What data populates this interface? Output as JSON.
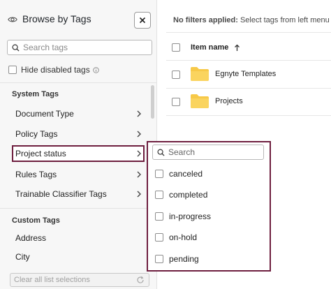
{
  "panel": {
    "title": "Browse by Tags",
    "search_placeholder": "Search tags",
    "hide_disabled_label": "Hide disabled tags",
    "system_tags_title": "System Tags",
    "system_tags": [
      {
        "label": "Document Type"
      },
      {
        "label": "Policy Tags"
      },
      {
        "label": "Project status"
      },
      {
        "label": "Rules Tags"
      },
      {
        "label": "Trainable Classifier Tags"
      }
    ],
    "custom_tags_title": "Custom Tags",
    "custom_tags": [
      {
        "label": "Address"
      },
      {
        "label": "City"
      }
    ],
    "clear_all_label": "Clear all list selections"
  },
  "content": {
    "filter_status_bold": "No filters applied:",
    "filter_status_text": " Select tags from left menu",
    "column_item_name": "Item name",
    "files": [
      {
        "name": "Egnyte Templates"
      },
      {
        "name": "Projects"
      }
    ]
  },
  "popup": {
    "search_placeholder": "Search",
    "options": [
      {
        "label": "canceled"
      },
      {
        "label": "completed"
      },
      {
        "label": "in-progress"
      },
      {
        "label": "on-hold"
      },
      {
        "label": "pending"
      }
    ]
  },
  "colors": {
    "highlight": "#6e1e3f",
    "folder": "#f7c948"
  },
  "icons": [
    "eye-icon",
    "close-icon",
    "search-icon",
    "info-icon",
    "chevron-right-icon",
    "sort-up-icon",
    "folder-icon",
    "refresh-icon"
  ]
}
